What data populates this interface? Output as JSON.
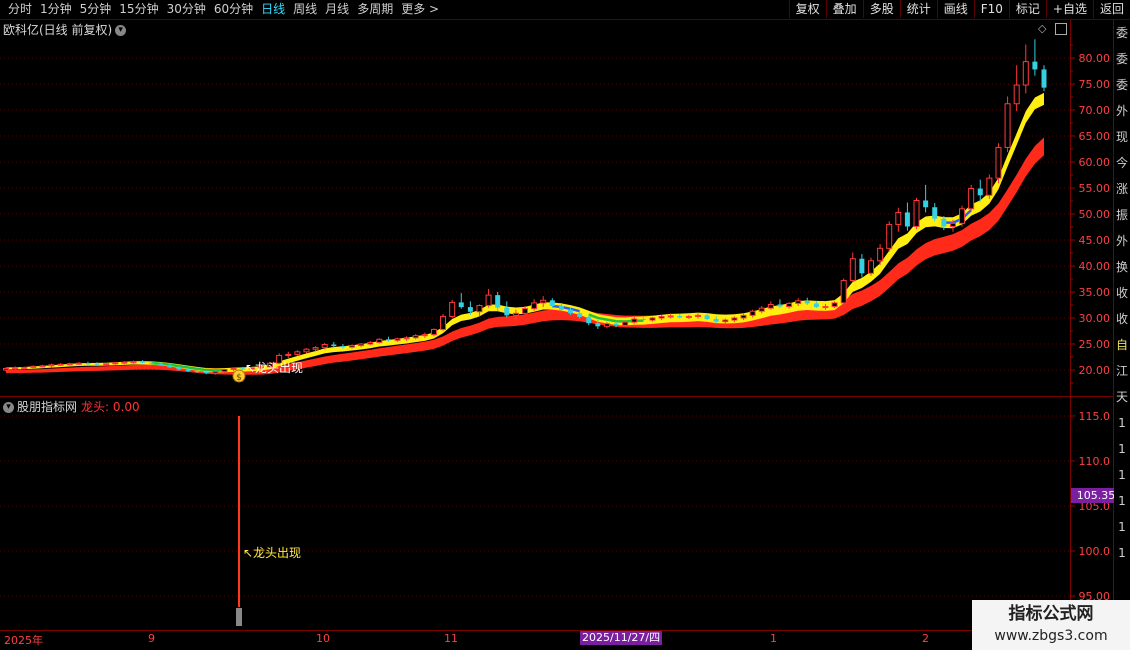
{
  "toolbar": {
    "periods": [
      "分时",
      "1分钟",
      "5分钟",
      "15分钟",
      "30分钟",
      "60分钟",
      "日线",
      "周线",
      "月线",
      "多周期",
      "更多 >"
    ],
    "active_period": "日线",
    "buttons": [
      "复权",
      "叠加",
      "多股",
      "统计",
      "画线",
      "F10",
      "标记",
      "+自选",
      "返回"
    ]
  },
  "main_chart": {
    "title": "欧科亿(日线 前复权)",
    "y_ticks": [
      "80.00",
      "75.00",
      "70.00",
      "65.00",
      "60.00",
      "55.00",
      "50.00",
      "45.00",
      "40.00",
      "35.00",
      "30.00",
      "25.00",
      "20.00"
    ],
    "annotation": "↖龙头出现",
    "coin_label": "$"
  },
  "sub_chart": {
    "title": "股朋指标网",
    "indicator_label": "龙头: 0.00",
    "y_ticks": [
      "115.0",
      "110.0",
      "105.0",
      "100.0",
      "95.00"
    ],
    "current_value": "105.35",
    "annotation": "↖龙头出现"
  },
  "date_axis": {
    "labels": [
      "2025年",
      "9",
      "10",
      "11",
      "1",
      "2"
    ],
    "selected": "2025/11/27/四"
  },
  "right_strip_chars": [
    "委",
    "委",
    "委",
    "外",
    "现",
    "今",
    "涨",
    "振",
    "外",
    "换",
    "收",
    "收",
    "自",
    "江",
    "天",
    "1",
    "1",
    "1",
    "1",
    "1",
    "1"
  ],
  "watermark": {
    "line1": "指标公式网",
    "line2": "www.zbgs3.com"
  },
  "chart_data": {
    "type": "candlestick",
    "ylim": [
      17,
      84
    ],
    "candles": [
      [
        20.0,
        20.5,
        19.7,
        20.3
      ],
      [
        20.3,
        20.7,
        20.0,
        20.4
      ],
      [
        20.4,
        20.6,
        20.1,
        20.5
      ],
      [
        20.5,
        20.9,
        20.3,
        20.7
      ],
      [
        20.7,
        21.0,
        20.5,
        20.8
      ],
      [
        20.8,
        21.2,
        20.5,
        21.0
      ],
      [
        21.0,
        21.3,
        20.8,
        21.1
      ],
      [
        21.1,
        21.4,
        20.9,
        21.2
      ],
      [
        21.2,
        21.5,
        21.0,
        21.3
      ],
      [
        21.3,
        21.6,
        21.0,
        21.2
      ],
      [
        21.2,
        21.5,
        20.9,
        21.1
      ],
      [
        21.1,
        21.3,
        20.8,
        21.2
      ],
      [
        21.2,
        21.5,
        21.0,
        21.4
      ],
      [
        21.4,
        21.7,
        21.1,
        21.5
      ],
      [
        21.5,
        21.8,
        21.2,
        21.6
      ],
      [
        21.6,
        21.9,
        21.3,
        21.4
      ],
      [
        21.4,
        21.7,
        21.1,
        21.2
      ],
      [
        21.2,
        21.5,
        20.8,
        20.9
      ],
      [
        20.9,
        21.1,
        20.4,
        20.5
      ],
      [
        20.5,
        20.8,
        19.9,
        20.1
      ],
      [
        20.1,
        20.4,
        19.6,
        19.8
      ],
      [
        19.8,
        20.1,
        19.4,
        19.6
      ],
      [
        19.6,
        19.9,
        19.2,
        19.4
      ],
      [
        19.4,
        19.8,
        19.1,
        19.7
      ],
      [
        19.7,
        20.2,
        19.5,
        20.1
      ],
      [
        20.1,
        20.5,
        19.8,
        20.3
      ],
      [
        20.3,
        20.6,
        20.0,
        20.2
      ],
      [
        20.2,
        20.5,
        19.9,
        20.4
      ],
      [
        20.4,
        20.8,
        20.1,
        20.6
      ],
      [
        20.6,
        21.5,
        20.4,
        21.3
      ],
      [
        21.3,
        23.2,
        21.1,
        22.8
      ],
      [
        22.8,
        23.5,
        22.3,
        23.0
      ],
      [
        23.0,
        23.8,
        22.7,
        23.5
      ],
      [
        23.5,
        24.2,
        23.2,
        24.0
      ],
      [
        24.0,
        24.6,
        23.6,
        24.3
      ],
      [
        24.3,
        25.2,
        24.0,
        24.9
      ],
      [
        24.9,
        25.4,
        24.3,
        24.6
      ],
      [
        24.6,
        25.0,
        24.1,
        24.4
      ],
      [
        24.4,
        24.9,
        24.1,
        24.7
      ],
      [
        24.7,
        25.2,
        24.4,
        25.0
      ],
      [
        25.0,
        25.6,
        24.7,
        25.3
      ],
      [
        25.3,
        26.1,
        25.1,
        25.9
      ],
      [
        25.9,
        26.4,
        25.4,
        25.7
      ],
      [
        25.7,
        26.2,
        25.4,
        26.0
      ],
      [
        26.0,
        26.5,
        25.6,
        26.2
      ],
      [
        26.2,
        26.9,
        25.9,
        26.6
      ],
      [
        26.6,
        27.2,
        26.2,
        26.8
      ],
      [
        26.8,
        28.0,
        26.5,
        27.8
      ],
      [
        27.8,
        30.8,
        27.5,
        30.3
      ],
      [
        30.3,
        33.5,
        30.0,
        33.0
      ],
      [
        33.0,
        34.8,
        31.8,
        32.1
      ],
      [
        32.1,
        33.2,
        30.6,
        31.2
      ],
      [
        31.2,
        32.6,
        30.4,
        32.4
      ],
      [
        32.4,
        35.6,
        32.0,
        34.4
      ],
      [
        34.4,
        35.0,
        31.4,
        32.0
      ],
      [
        32.0,
        33.2,
        30.1,
        30.5
      ],
      [
        30.5,
        31.6,
        29.6,
        30.9
      ],
      [
        30.9,
        32.3,
        30.4,
        31.8
      ],
      [
        31.8,
        33.6,
        31.4,
        32.9
      ],
      [
        32.9,
        34.2,
        32.1,
        33.4
      ],
      [
        33.4,
        33.8,
        31.9,
        32.3
      ],
      [
        32.3,
        32.9,
        31.3,
        31.6
      ],
      [
        31.6,
        32.0,
        30.6,
        30.9
      ],
      [
        30.9,
        31.4,
        29.9,
        30.2
      ],
      [
        30.2,
        30.6,
        28.6,
        29.0
      ],
      [
        29.0,
        29.6,
        27.9,
        28.4
      ],
      [
        28.4,
        29.2,
        28.0,
        28.9
      ],
      [
        28.9,
        29.4,
        28.2,
        28.6
      ],
      [
        28.6,
        29.5,
        28.3,
        29.2
      ],
      [
        29.2,
        30.2,
        28.9,
        29.8
      ],
      [
        29.8,
        30.4,
        29.3,
        29.6
      ],
      [
        29.6,
        30.2,
        29.3,
        30.0
      ],
      [
        30.0,
        30.6,
        29.6,
        30.3
      ],
      [
        30.3,
        30.9,
        29.9,
        30.4
      ],
      [
        30.4,
        30.8,
        29.9,
        30.1
      ],
      [
        30.1,
        30.6,
        29.8,
        30.3
      ],
      [
        30.3,
        30.9,
        29.9,
        30.5
      ],
      [
        30.5,
        30.8,
        29.6,
        29.8
      ],
      [
        29.8,
        30.3,
        28.9,
        29.3
      ],
      [
        29.3,
        29.9,
        28.8,
        29.6
      ],
      [
        29.6,
        30.3,
        29.2,
        30.0
      ],
      [
        30.0,
        30.8,
        29.6,
        30.5
      ],
      [
        30.5,
        31.6,
        30.1,
        31.3
      ],
      [
        31.3,
        32.3,
        30.9,
        31.9
      ],
      [
        31.9,
        33.2,
        31.6,
        32.6
      ],
      [
        32.6,
        33.6,
        31.9,
        32.2
      ],
      [
        32.2,
        33.1,
        31.8,
        32.8
      ],
      [
        32.8,
        33.8,
        32.3,
        33.3
      ],
      [
        33.3,
        33.9,
        32.5,
        32.8
      ],
      [
        32.8,
        33.3,
        31.9,
        32.1
      ],
      [
        32.1,
        32.7,
        31.6,
        32.2
      ],
      [
        32.2,
        33.2,
        31.9,
        32.9
      ],
      [
        32.9,
        37.6,
        32.6,
        37.2
      ],
      [
        37.2,
        42.6,
        36.9,
        41.4
      ],
      [
        41.4,
        42.3,
        37.8,
        38.6
      ],
      [
        38.6,
        41.6,
        38.1,
        41.0
      ],
      [
        41.0,
        44.2,
        40.2,
        43.4
      ],
      [
        43.4,
        48.6,
        42.8,
        48.0
      ],
      [
        48.0,
        51.2,
        46.6,
        50.3
      ],
      [
        50.3,
        52.2,
        46.8,
        47.6
      ],
      [
        47.6,
        53.1,
        47.1,
        52.6
      ],
      [
        52.6,
        55.6,
        50.3,
        51.3
      ],
      [
        51.3,
        52.1,
        48.6,
        49.1
      ],
      [
        49.1,
        49.6,
        46.9,
        47.6
      ],
      [
        47.6,
        48.9,
        46.6,
        48.2
      ],
      [
        48.2,
        51.6,
        47.6,
        51.0
      ],
      [
        51.0,
        55.6,
        50.6,
        54.9
      ],
      [
        54.9,
        56.6,
        52.3,
        53.6
      ],
      [
        53.6,
        57.6,
        52.9,
        56.9
      ],
      [
        56.9,
        63.6,
        55.9,
        62.8
      ],
      [
        62.8,
        72.6,
        61.9,
        71.2
      ],
      [
        71.2,
        78.6,
        69.8,
        74.8
      ],
      [
        74.8,
        82.6,
        73.2,
        79.3
      ],
      [
        79.3,
        83.6,
        76.6,
        77.8
      ],
      [
        77.8,
        78.6,
        73.6,
        74.3
      ]
    ],
    "dragon_value": 0.0,
    "sub_ylim": [
      93.5,
      116.5
    ],
    "current_value": 105.35
  }
}
